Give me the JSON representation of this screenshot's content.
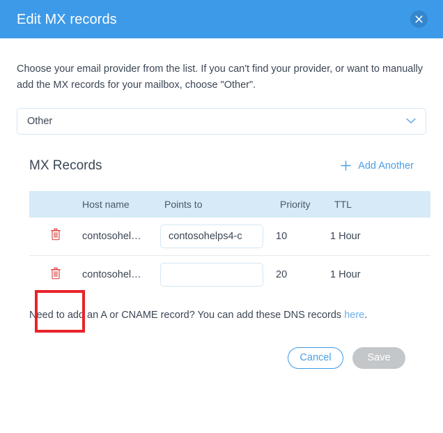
{
  "header": {
    "title": "Edit MX records",
    "close_icon": "close-icon"
  },
  "intro": "Choose your email provider from the list. If you can't find your provider, or want to manually add the MX records for your mailbox, choose \"Other\".",
  "provider_select": {
    "value": "Other",
    "chevron_icon": "chevron-down-icon"
  },
  "records": {
    "title": "MX Records",
    "add_another_label": "Add Another",
    "add_icon": "plus-icon",
    "columns": {
      "delete": "",
      "host": "Host name",
      "points_to": "Points to",
      "priority": "Priority",
      "ttl": "TTL"
    },
    "rows": [
      {
        "delete_icon": "trash-icon",
        "host": "contosohel…",
        "points_to_value": "contosohelps4-c",
        "points_to_placeholder": "",
        "priority": "10",
        "ttl": "1 Hour"
      },
      {
        "delete_icon": "trash-icon",
        "host": "contosohel…",
        "points_to_value": "",
        "points_to_placeholder": "",
        "priority": "20",
        "ttl": "1 Hour"
      }
    ]
  },
  "note": {
    "text_before": "Need to add an A or CNAME record? You can add these DNS records ",
    "link_label": "here",
    "text_after": "."
  },
  "actions": {
    "cancel_label": "Cancel",
    "save_label": "Save"
  },
  "colors": {
    "header_blue": "#3d9ae8",
    "table_header_blue": "#d6eaf8",
    "link_blue": "#4a9fe8",
    "trash_red": "#dd4b4b",
    "highlight_red": "#e8232a",
    "save_disabled_gray": "#c3c7ca"
  }
}
